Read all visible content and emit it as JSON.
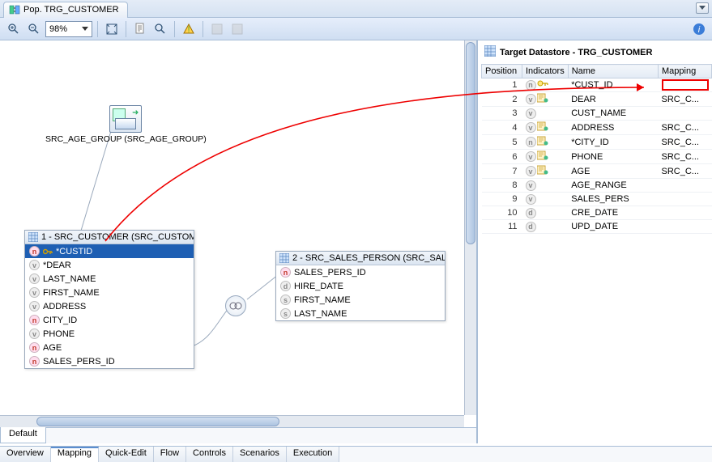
{
  "tab": {
    "title": "Pop. TRG_CUSTOMER"
  },
  "toolbar": {
    "zoom_value": "98%"
  },
  "canvas": {
    "default_tab": "Default",
    "src_age": {
      "label": "SRC_AGE_GROUP (SRC_AGE_GROUP)"
    },
    "src_customer": {
      "title": "1 - SRC_CUSTOMER (SRC_CUSTOMI",
      "cols": [
        {
          "t": "n",
          "key": true,
          "name": "*CUSTID",
          "sel": true
        },
        {
          "t": "v",
          "name": "*DEAR"
        },
        {
          "t": "v",
          "name": "LAST_NAME"
        },
        {
          "t": "v",
          "name": "FIRST_NAME"
        },
        {
          "t": "v",
          "name": "ADDRESS"
        },
        {
          "t": "n",
          "name": "CITY_ID"
        },
        {
          "t": "v",
          "name": "PHONE"
        },
        {
          "t": "n",
          "name": "AGE"
        },
        {
          "t": "n",
          "name": "SALES_PERS_ID"
        }
      ]
    },
    "src_sales": {
      "title": "2 - SRC_SALES_PERSON (SRC_SAL",
      "cols": [
        {
          "t": "n",
          "name": "SALES_PERS_ID"
        },
        {
          "t": "d",
          "name": "HIRE_DATE"
        },
        {
          "t": "s",
          "name": "FIRST_NAME"
        },
        {
          "t": "s",
          "name": "LAST_NAME"
        }
      ]
    }
  },
  "target": {
    "title": "Target Datastore - TRG_CUSTOMER",
    "headers": {
      "pos": "Position",
      "ind": "Indicators",
      "name": "Name",
      "map": "Mapping"
    },
    "rows": [
      {
        "pos": 1,
        "ind": "n",
        "icon": "key",
        "name": "*CUST_ID",
        "map": ""
      },
      {
        "pos": 2,
        "ind": "v",
        "icon": "fx",
        "name": "DEAR",
        "map": "SRC_C..."
      },
      {
        "pos": 3,
        "ind": "v",
        "icon": "",
        "name": "CUST_NAME",
        "map": ""
      },
      {
        "pos": 4,
        "ind": "v",
        "icon": "fx",
        "name": "ADDRESS",
        "map": "SRC_C..."
      },
      {
        "pos": 5,
        "ind": "n",
        "icon": "fx",
        "name": "*CITY_ID",
        "map": "SRC_C..."
      },
      {
        "pos": 6,
        "ind": "v",
        "icon": "fx",
        "name": "PHONE",
        "map": "SRC_C..."
      },
      {
        "pos": 7,
        "ind": "v",
        "icon": "fx",
        "name": "AGE",
        "map": "SRC_C..."
      },
      {
        "pos": 8,
        "ind": "v",
        "icon": "",
        "name": "AGE_RANGE",
        "map": ""
      },
      {
        "pos": 9,
        "ind": "v",
        "icon": "",
        "name": "SALES_PERS",
        "map": ""
      },
      {
        "pos": 10,
        "ind": "d",
        "icon": "",
        "name": "CRE_DATE",
        "map": ""
      },
      {
        "pos": 11,
        "ind": "d",
        "icon": "",
        "name": "UPD_DATE",
        "map": ""
      }
    ]
  },
  "bottom_tabs": [
    "Overview",
    "Mapping",
    "Quick-Edit",
    "Flow",
    "Controls",
    "Scenarios",
    "Execution"
  ],
  "active_bottom_tab": "Mapping"
}
